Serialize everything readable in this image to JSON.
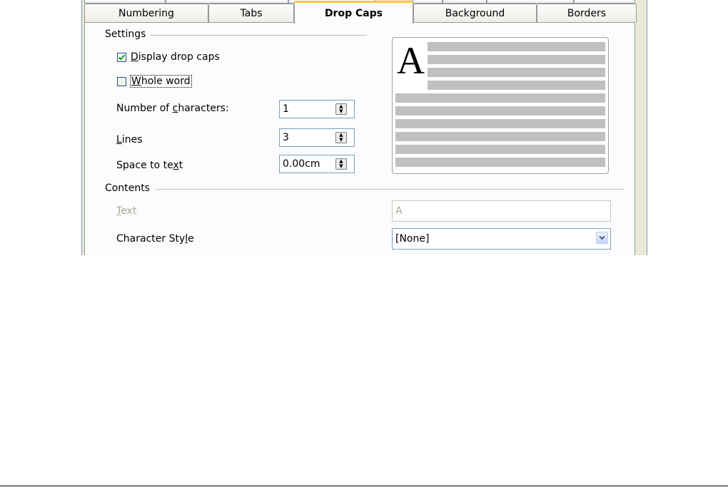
{
  "tabs": {
    "numbering": "Numbering",
    "tabs": "Tabs",
    "drop_caps": "Drop Caps",
    "background": "Background",
    "borders": "Borders"
  },
  "settings": {
    "heading": "Settings",
    "display_drop_caps": {
      "pre": "",
      "key": "D",
      "post": "isplay drop caps",
      "checked": true
    },
    "whole_word": {
      "pre": "",
      "key": "W",
      "post": "hole word",
      "checked": false
    },
    "num_chars": {
      "pre": "Number of ",
      "key": "c",
      "post": "haracters:",
      "value": "1"
    },
    "lines": {
      "pre": "",
      "key": "L",
      "post": "ines",
      "value": "3"
    },
    "space_to_text": {
      "pre": "Space to te",
      "key": "x",
      "post": "t",
      "value": "0.00cm"
    }
  },
  "preview": {
    "drop_letter": "A"
  },
  "contents": {
    "heading": "Contents",
    "text": {
      "pre": "",
      "key": "T",
      "post": "ext",
      "value": "A"
    },
    "char_style": {
      "pre": "Character Sty",
      "key": "l",
      "post": "e",
      "value": "[None]"
    }
  },
  "colors": {
    "active_tab_accent": "#ffc83c",
    "dialog_bg": "#ece9d8",
    "panel_bg": "#fcfcfe"
  }
}
